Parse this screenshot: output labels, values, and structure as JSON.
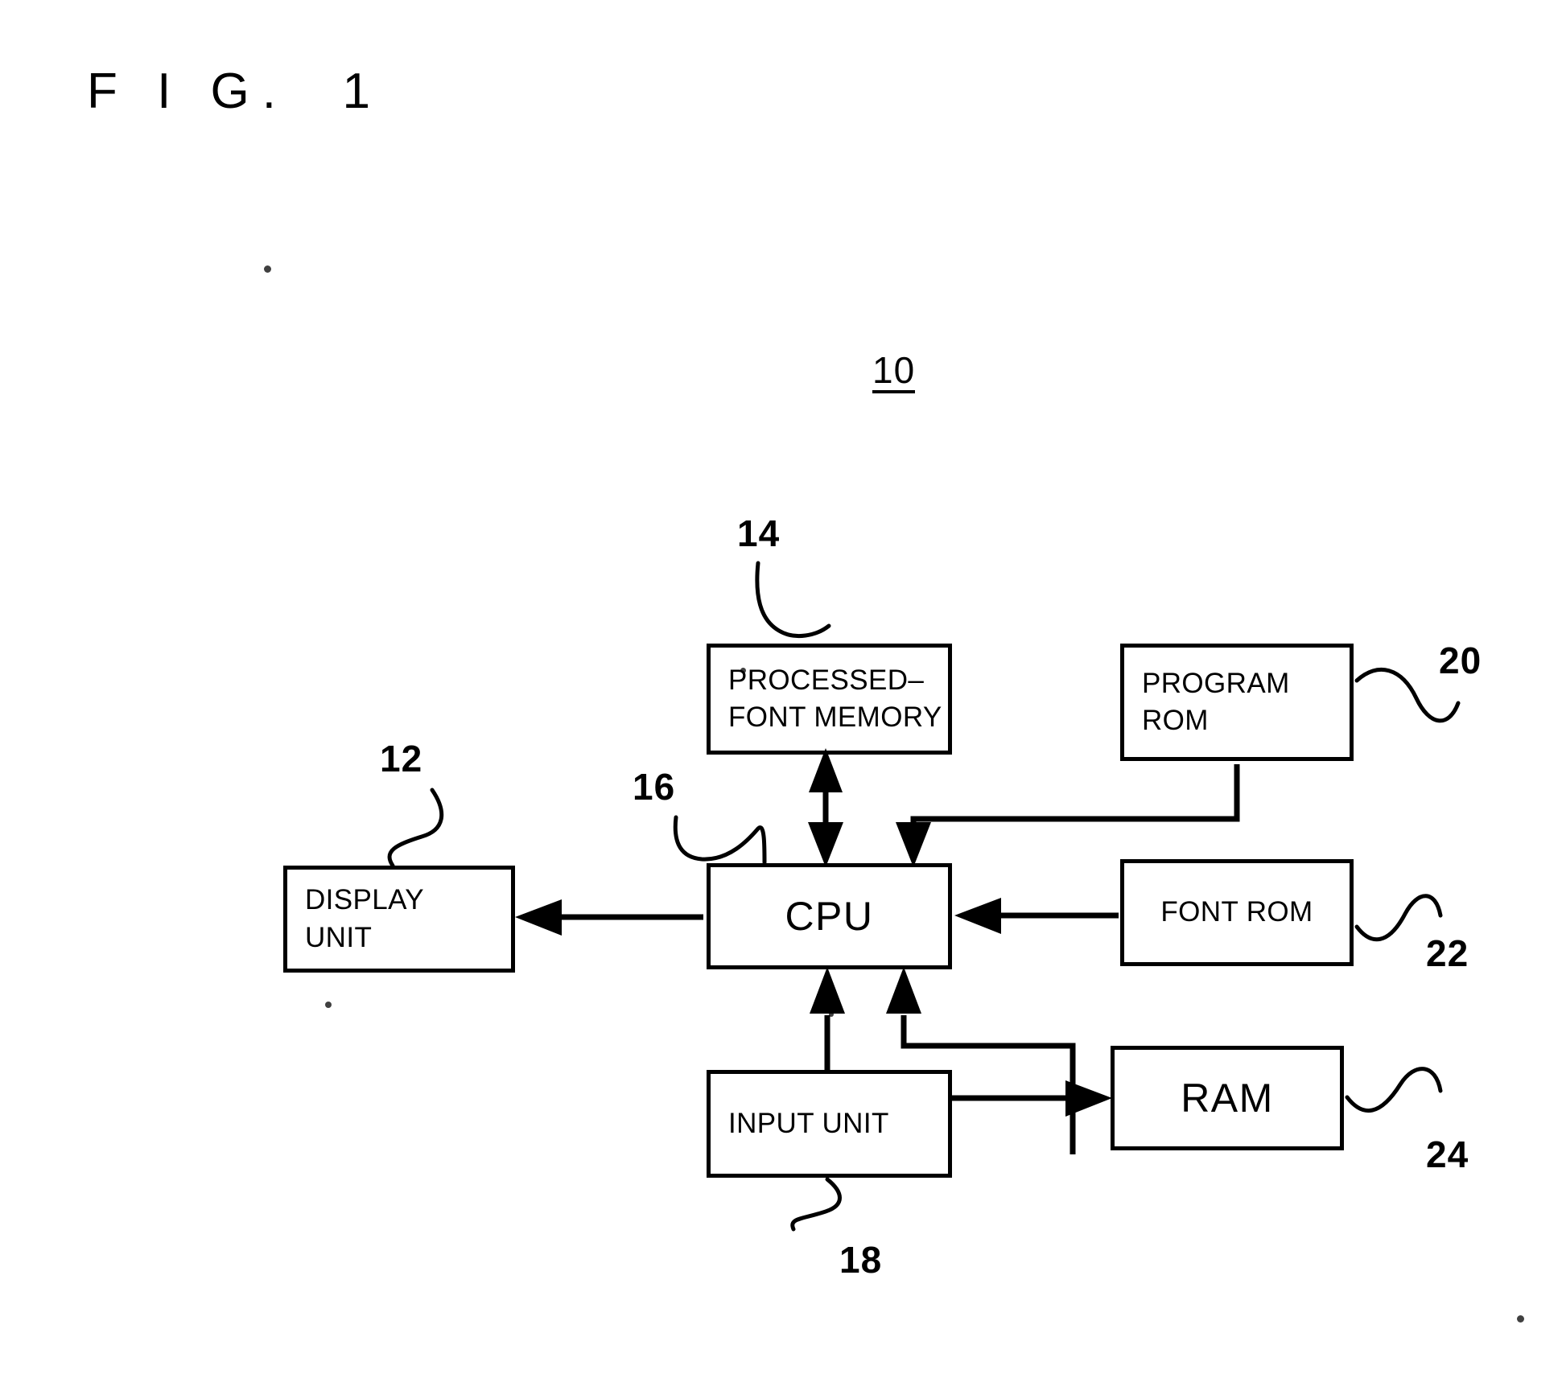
{
  "figure": {
    "title": "F I G.  1",
    "system_reference": "10"
  },
  "blocks": [
    {
      "id": "processed-font-memory",
      "label": "PROCESSED–\nFONT MEMORY",
      "reference": "14"
    },
    {
      "id": "program-rom",
      "label": "PROGRAM\nROM",
      "reference": "20"
    },
    {
      "id": "display-unit",
      "label": "DISPLAY\nUNIT",
      "reference": "12"
    },
    {
      "id": "cpu",
      "label": "CPU",
      "reference": "16"
    },
    {
      "id": "font-rom",
      "label": "FONT ROM",
      "reference": "22"
    },
    {
      "id": "input-unit",
      "label": "INPUT UNIT",
      "reference": "18"
    },
    {
      "id": "ram",
      "label": "RAM",
      "reference": "24"
    }
  ],
  "connections": [
    {
      "id": "cpu-processed-font-memory",
      "from": "cpu",
      "to": "processed-font-memory",
      "direction": "bidirectional"
    },
    {
      "id": "program-rom-cpu",
      "from": "program-rom",
      "to": "cpu",
      "direction": "unidirectional"
    },
    {
      "id": "cpu-display-unit",
      "from": "cpu",
      "to": "display-unit",
      "direction": "unidirectional"
    },
    {
      "id": "font-rom-cpu",
      "from": "font-rom",
      "to": "cpu",
      "direction": "unidirectional"
    },
    {
      "id": "input-unit-cpu",
      "from": "input-unit",
      "to": "cpu",
      "direction": "unidirectional"
    },
    {
      "id": "input-unit-ram",
      "from": "input-unit",
      "to": "ram",
      "direction": "unidirectional"
    },
    {
      "id": "ram-cpu",
      "from": "ram",
      "to": "cpu",
      "direction": "unidirectional"
    }
  ],
  "colors": {
    "ink": "#000000",
    "paper": "#ffffff"
  }
}
